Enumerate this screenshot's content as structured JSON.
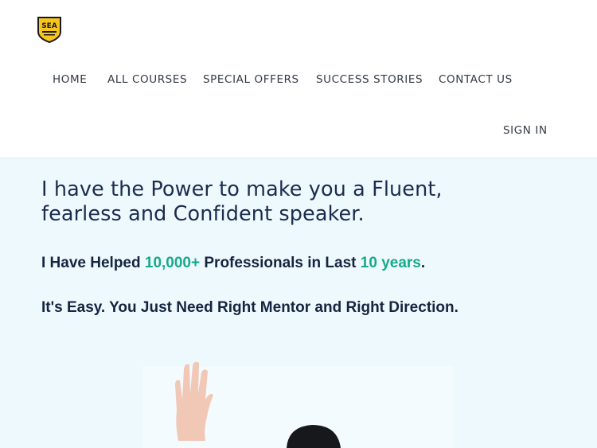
{
  "brand": {
    "logo_text": "SEA"
  },
  "nav": {
    "home": "HOME",
    "courses": "ALL COURSES",
    "offers": "SPECIAL OFFERS",
    "stories": "SUCCESS STORIES",
    "contact": "CONTACT US",
    "sign_in": "SIGN IN"
  },
  "hero": {
    "headline_1": "I have the Power to make you a Fluent,",
    "headline_2": "fearless and Confident speaker.",
    "line1_a": "I Have Helped ",
    "line1_num": "10,000+",
    "line1_b": " Professionals in Last ",
    "line1_years": "10 years",
    "line1_c": ".",
    "line2": "It's Easy. You Just Need Right Mentor and Right Direction."
  },
  "colors": {
    "accent": "#17a98a",
    "hero_bg": "#eef9fd",
    "heading": "#1b2c4f",
    "logo_yellow": "#f7c51d"
  },
  "icons": {
    "logo": "shield-logo-icon"
  }
}
